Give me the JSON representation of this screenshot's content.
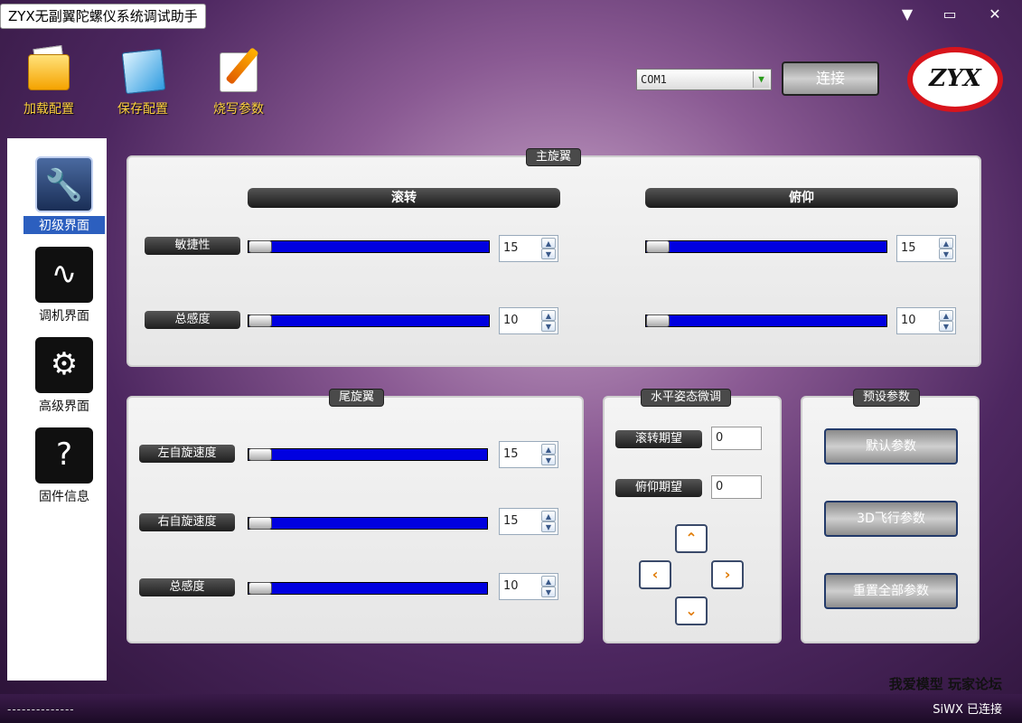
{
  "window": {
    "title": "ZYX无副翼陀螺仪系统调试助手",
    "minimize_icon": "▼",
    "restore_icon": "▭",
    "close_icon": "✕"
  },
  "toolbar": {
    "load_label": "加载配置",
    "save_label": "保存配置",
    "burn_label": "烧写参数",
    "com_port": "COM1",
    "connect_label": "连接",
    "logo_text": "ZYX"
  },
  "sidebar": {
    "items": [
      {
        "label": "初级界面",
        "icon": "wrench-icon",
        "glyph": "🔧"
      },
      {
        "label": "调机界面",
        "icon": "pulse-icon",
        "glyph": "∿"
      },
      {
        "label": "高级界面",
        "icon": "gear-icon",
        "glyph": "⚙"
      },
      {
        "label": "固件信息",
        "icon": "firmware-icon",
        "glyph": "?"
      }
    ]
  },
  "main_rotor": {
    "title": "主旋翼",
    "roll_header": "滚转",
    "pitch_header": "俯仰",
    "agility_label": "敏捷性",
    "gain_label": "总感度",
    "roll_agility": "15",
    "roll_gain": "10",
    "pitch_agility": "15",
    "pitch_gain": "10"
  },
  "tail_rotor": {
    "title": "尾旋翼",
    "left_spin_label": "左自旋速度",
    "right_spin_label": "右自旋速度",
    "gain_label": "总感度",
    "left_spin": "15",
    "right_spin": "15",
    "gain": "10"
  },
  "level_trim": {
    "title": "水平姿态微调",
    "roll_expect_label": "滚转期望",
    "pitch_expect_label": "俯仰期望",
    "roll_expect": "0",
    "pitch_expect": "0"
  },
  "presets": {
    "title": "预设参数",
    "default_label": "默认参数",
    "flight3d_label": "3D飞行参数",
    "reset_label": "重置全部参数"
  },
  "footer": {
    "forum": "我爱模型 玩家论坛",
    "status_left": "--------------",
    "status_right": "SiWX 已连接"
  }
}
